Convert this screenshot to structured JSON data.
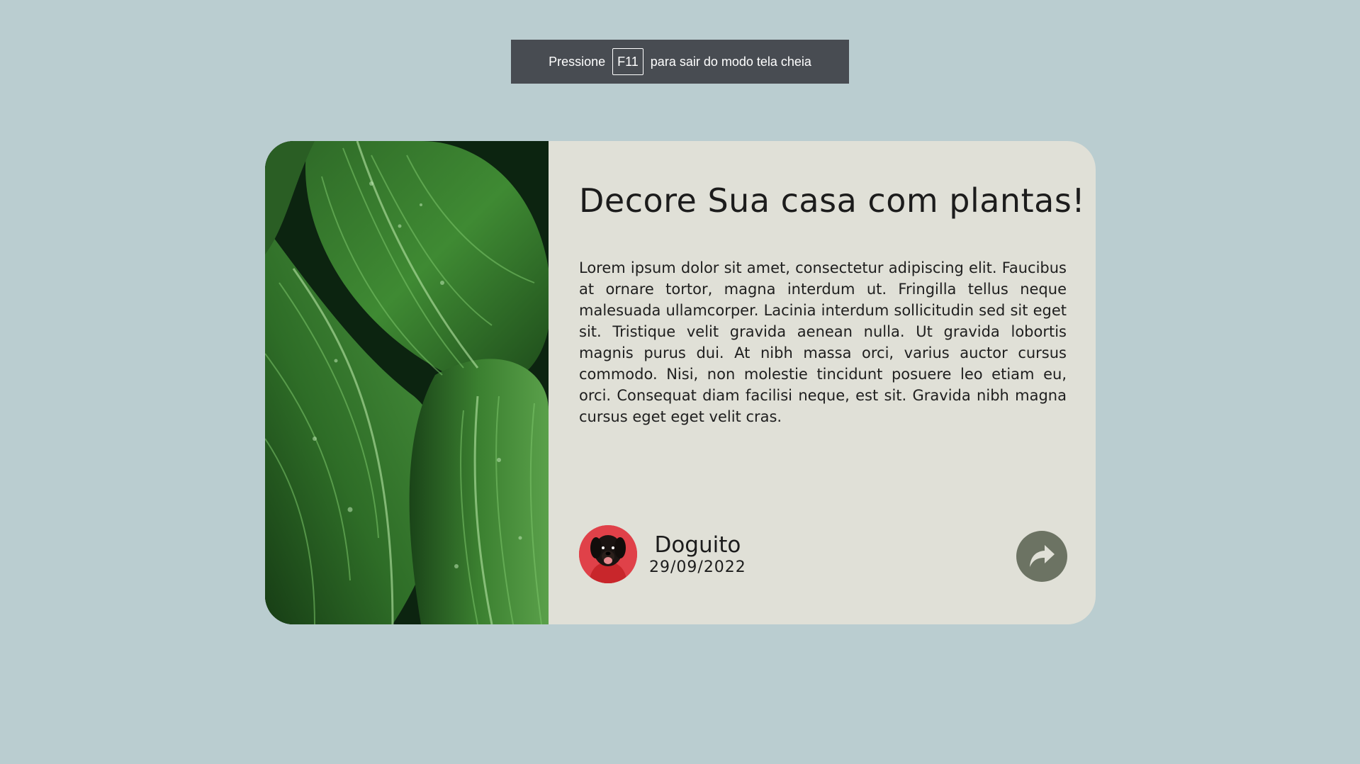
{
  "fullscreen_notice": {
    "before": "Pressione",
    "key": "F11",
    "after": "para sair do modo tela cheia"
  },
  "card": {
    "image_description_icon": "plant-leaves-photo",
    "title": "Decore Sua casa com plantas!",
    "description": "Lorem ipsum dolor sit amet, consectetur adipiscing elit. Faucibus at ornare tortor, magna interdum ut. Fringilla tellus neque malesuada ullamcorper. Lacinia interdum sollicitudin sed sit eget sit. Tristique velit gravida aenean nulla. Ut gravida lobortis magnis purus dui. At nibh massa orci, varius auctor cursus commodo. Nisi, non molestie tincidunt posuere leo etiam eu, orci. Consequat diam facilisi neque, est sit. Gravida nibh magna cursus eget eget velit cras.",
    "author": {
      "name": "Doguito",
      "date": "29/09/2022",
      "avatar_icon": "dog-avatar"
    },
    "share_icon": "share-arrow-icon"
  },
  "colors": {
    "page_background": "#bacdd0",
    "card_background": "#e0e0d7",
    "share_button": "#6c7363",
    "toast_background": "#484c52",
    "avatar_background": "#e04149"
  }
}
